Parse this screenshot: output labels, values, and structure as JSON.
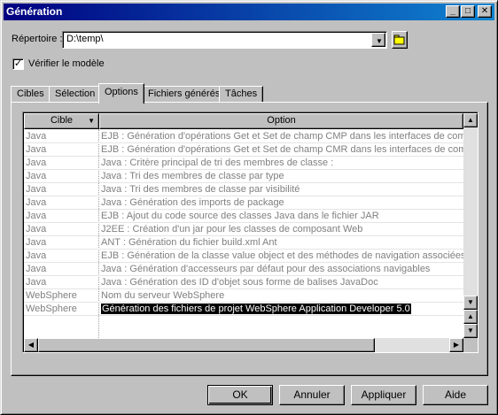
{
  "window": {
    "title": "Génération"
  },
  "title_buttons": {
    "minimize": "_",
    "maximize": "□",
    "close": "✕"
  },
  "directory": {
    "label": "Répertoire :",
    "value": "D:\\temp\\"
  },
  "verify": {
    "label": "Vérifier le modèle",
    "checked": true,
    "checkmark": "✓"
  },
  "tabs": [
    {
      "label": "Cibles"
    },
    {
      "label": "Sélection"
    },
    {
      "label": "Options"
    },
    {
      "label": "Fichiers générés"
    },
    {
      "label": "Tâches"
    }
  ],
  "grid": {
    "columns": {
      "target": "Cible",
      "option": "Option"
    },
    "rows": [
      {
        "target": "Java",
        "option": "EJB : Génération d'opérations Get et Set de champ CMP dans les interfaces de compo"
      },
      {
        "target": "Java",
        "option": "EJB : Génération d'opérations Get et Set de champ CMR dans les interfaces de compo"
      },
      {
        "target": "Java",
        "option": "Java : Critère principal de tri des membres de classe :"
      },
      {
        "target": "Java",
        "option": "Java : Tri des membres de classe par type"
      },
      {
        "target": "Java",
        "option": "Java : Tri des membres de classe par visibilité"
      },
      {
        "target": "Java",
        "option": "Java : Génération des imports de package"
      },
      {
        "target": "Java",
        "option": "EJB : Ajout du code source des classes Java dans le fichier JAR"
      },
      {
        "target": "Java",
        "option": "J2EE : Création d'un jar pour les classes de composant Web"
      },
      {
        "target": "Java",
        "option": "ANT : Génération du fichier build.xml Ant"
      },
      {
        "target": "Java",
        "option": "EJB : Génération de la classe value object et des méthodes de navigation associées p"
      },
      {
        "target": "Java",
        "option": "Java : Génération d'accesseurs par défaut pour des associations navigables"
      },
      {
        "target": "Java",
        "option": "Java : Génération des ID d'objet sous forme de balises JavaDoc"
      },
      {
        "target": "WebSphere",
        "option": "Nom du serveur WebSphere"
      },
      {
        "target": "WebSphere",
        "option": "Génération des fichiers de projet WebSphere Application Developer 5.0",
        "selected": true
      }
    ]
  },
  "buttons": {
    "ok": "OK",
    "cancel": "Annuler",
    "apply": "Appliquer",
    "help": "Aide"
  }
}
